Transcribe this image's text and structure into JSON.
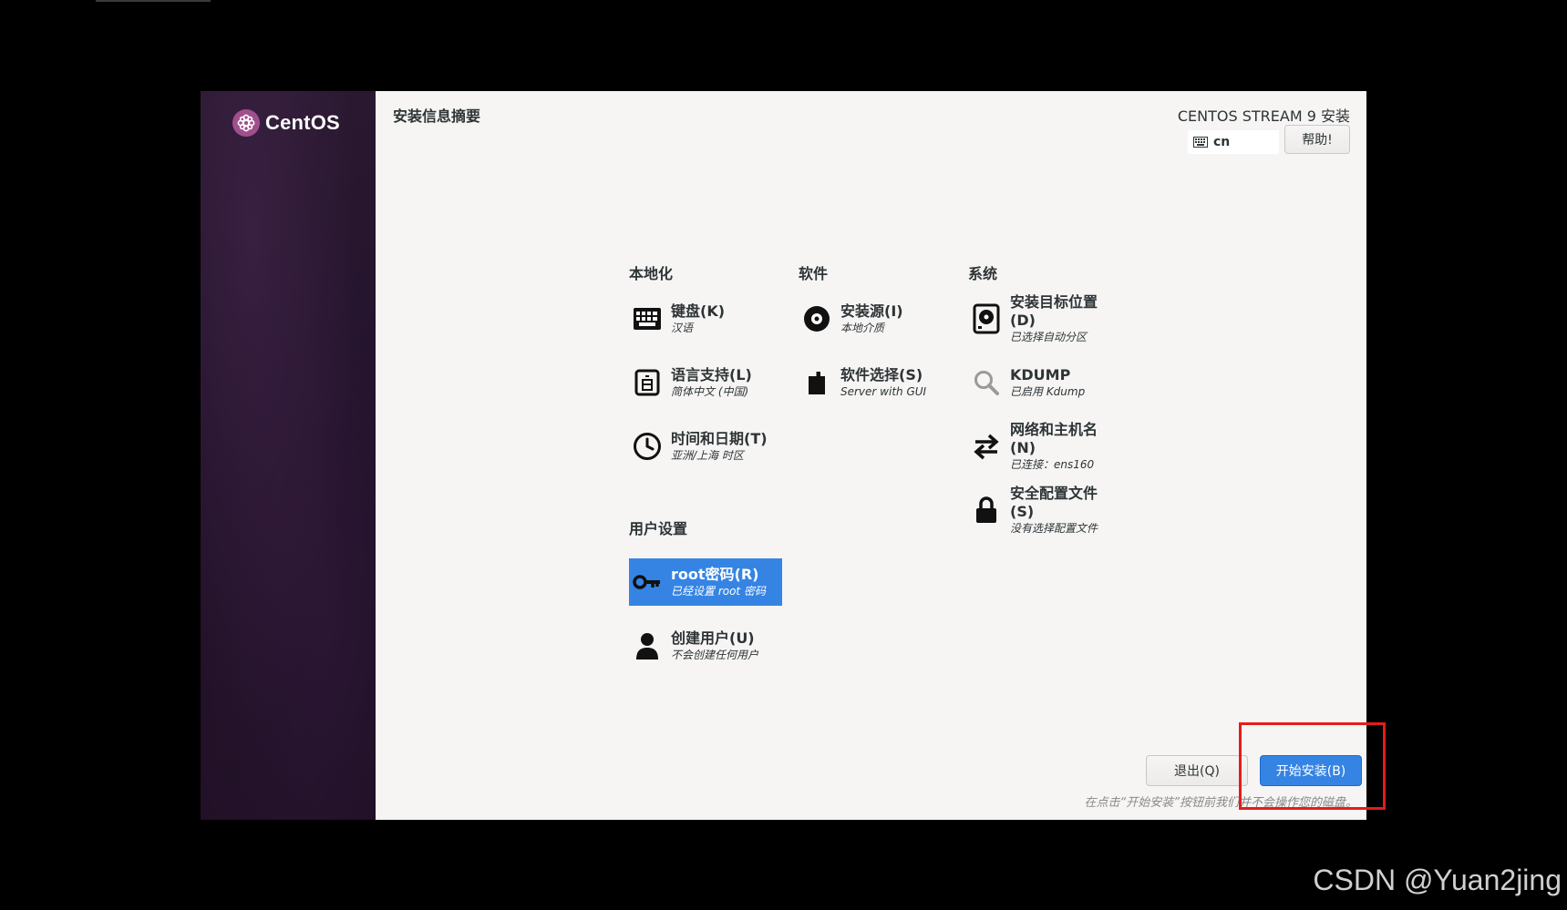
{
  "sidebar": {
    "logo_text": "CentOS"
  },
  "header": {
    "page_title": "安装信息摘要",
    "product_title": "CENTOS STREAM 9 安装",
    "keyboard_layout": "cn",
    "help_label": "帮助!"
  },
  "sections": {
    "localization": "本地化",
    "software": "软件",
    "system": "系统",
    "user_settings": "用户设置"
  },
  "spokes": {
    "keyboard": {
      "name": "键盘(K)",
      "status": "汉语",
      "icon": "keyboard-icon"
    },
    "language": {
      "name": "语言支持(L)",
      "status": "简体中文 (中国)",
      "icon": "language-icon"
    },
    "datetime": {
      "name": "时间和日期(T)",
      "status": "亚洲/上海 时区",
      "icon": "clock-icon"
    },
    "source": {
      "name": "安装源(I)",
      "status": "本地介质",
      "icon": "disc-icon"
    },
    "software": {
      "name": "软件选择(S)",
      "status": "Server with GUI",
      "icon": "package-icon"
    },
    "destination": {
      "name": "安装目标位置(D)",
      "status": "已选择自动分区",
      "icon": "harddisk-icon"
    },
    "kdump": {
      "name": "KDUMP",
      "status": "已启用 Kdump",
      "icon": "search-icon"
    },
    "network": {
      "name": "网络和主机名(N)",
      "status": "已连接：ens160",
      "icon": "network-arrows-icon"
    },
    "security": {
      "name": "安全配置文件(S)",
      "status": "没有选择配置文件",
      "icon": "lock-icon"
    },
    "root": {
      "name": "root密码(R)",
      "status": "已经设置 root 密码",
      "icon": "key-icon"
    },
    "user": {
      "name": "创建用户(U)",
      "status": "不会创建任何用户",
      "icon": "user-icon"
    }
  },
  "footer": {
    "quit_label": "退出(Q)",
    "begin_label": "开始安装(B)",
    "hint": "在点击“开始安装”按钮前我们并不会操作您的磁盘。"
  },
  "watermark": "CSDN @Yuan2jing",
  "colors": {
    "accent": "#3584e4",
    "highlight": "#e51c1c",
    "sidebar": "#22122a"
  }
}
